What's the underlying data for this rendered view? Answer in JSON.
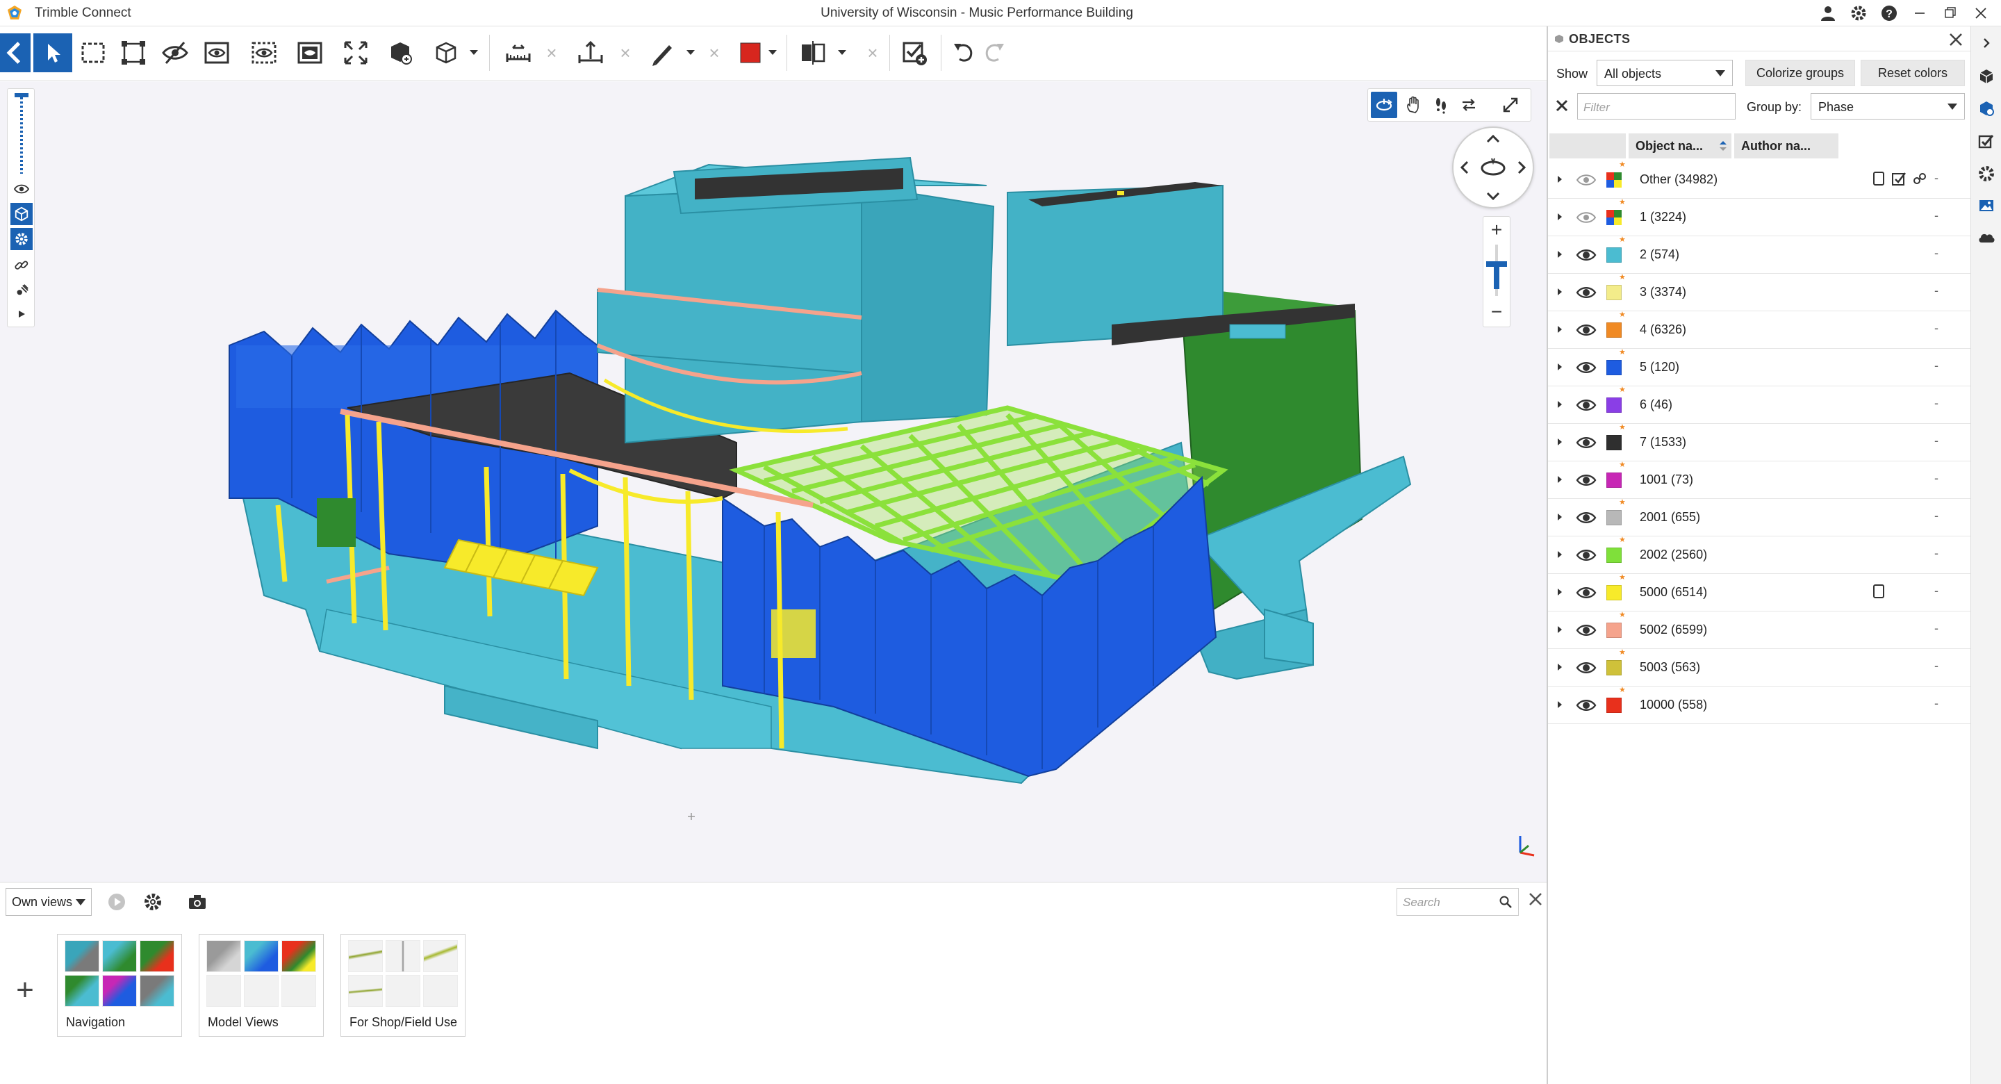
{
  "app": {
    "name": "Trimble Connect",
    "document_title": "University of Wisconsin - Music Performance Building"
  },
  "window_icons": [
    "user-icon",
    "gear-icon",
    "help-icon",
    "minimize-icon",
    "restore-icon",
    "close-icon"
  ],
  "toolbar": {
    "tools": [
      "back-icon",
      "select-icon",
      "box-select-icon",
      "fit-select-icon",
      "hide-icon",
      "isolate-icon",
      "show-all-icon",
      "clip-icon",
      "fit-all-icon",
      "object-3d-icon",
      "view-cube-icon",
      "measure-icon",
      "level-icon",
      "markup-pen-icon",
      "color-picker-icon",
      "section-icon",
      "create-todo-icon",
      "undo-icon",
      "redo-icon"
    ],
    "accent_color": "#1b62b3",
    "markup_color": "#d7261e"
  },
  "viewport": {
    "background": "#f4f3f8",
    "left_tools": [
      "slider-icon",
      "eye-icon",
      "cube-icon",
      "gear-icon",
      "link-icon",
      "sun-icon",
      "play-icon"
    ],
    "nav_modes": [
      "orbit-icon",
      "pan-icon",
      "walk-icon",
      "swap-icon",
      "fullscreen-icon"
    ],
    "zoom": {
      "plus": "+",
      "minus": "−"
    }
  },
  "bottom_panel": {
    "views_filter": "Own views",
    "search_placeholder": "Search",
    "add_label": "+",
    "cards": [
      {
        "label": "Navigation"
      },
      {
        "label": "Model Views"
      },
      {
        "label": "For Shop/Field Use"
      }
    ]
  },
  "objects_panel": {
    "title": "OBJECTS",
    "show_label": "Show",
    "show_value": "All objects",
    "colorize_button": "Colorize groups",
    "reset_button": "Reset colors",
    "filter_placeholder": "Filter",
    "group_by_label": "Group by:",
    "group_by_value": "Phase",
    "columns": [
      "Object na...",
      "Author na..."
    ],
    "rows": [
      {
        "name": "Other (34982)",
        "color": "multi",
        "visible": false,
        "author": "-"
      },
      {
        "name": "1 (3224)",
        "color": "multi",
        "visible": false,
        "author": "-"
      },
      {
        "name": "2 (574)",
        "color": "#4bbcd1",
        "visible": true,
        "author": "-"
      },
      {
        "name": "3 (3374)",
        "color": "#f3ec8a",
        "visible": true,
        "author": "-"
      },
      {
        "name": "4 (6326)",
        "color": "#f08a24",
        "visible": true,
        "author": "-"
      },
      {
        "name": "5 (120)",
        "color": "#1e5ce0",
        "visible": true,
        "author": "-"
      },
      {
        "name": "6 (46)",
        "color": "#8a3ee6",
        "visible": true,
        "author": "-"
      },
      {
        "name": "7 (1533)",
        "color": "#2f2f2f",
        "visible": true,
        "author": "-"
      },
      {
        "name": "1001 (73)",
        "color": "#c727b5",
        "visible": true,
        "author": "-"
      },
      {
        "name": "2001 (655)",
        "color": "#b8b8b8",
        "visible": true,
        "author": "-"
      },
      {
        "name": "2002 (2560)",
        "color": "#7fe03a",
        "visible": true,
        "author": "-"
      },
      {
        "name": "5000 (6514)",
        "color": "#f7ea2a",
        "visible": true,
        "author": "-"
      },
      {
        "name": "5002 (6599)",
        "color": "#f5a38c",
        "visible": true,
        "author": "-"
      },
      {
        "name": "5003 (563)",
        "color": "#cfc13a",
        "visible": true,
        "author": "-"
      },
      {
        "name": "10000 (558)",
        "color": "#e8301c",
        "visible": true,
        "author": "-"
      }
    ]
  },
  "right_rail": [
    "collapse-arrow-icon",
    "models-icon",
    "objects-icon",
    "todo-icon",
    "settings-icon",
    "views-icon",
    "cloud-icon"
  ]
}
